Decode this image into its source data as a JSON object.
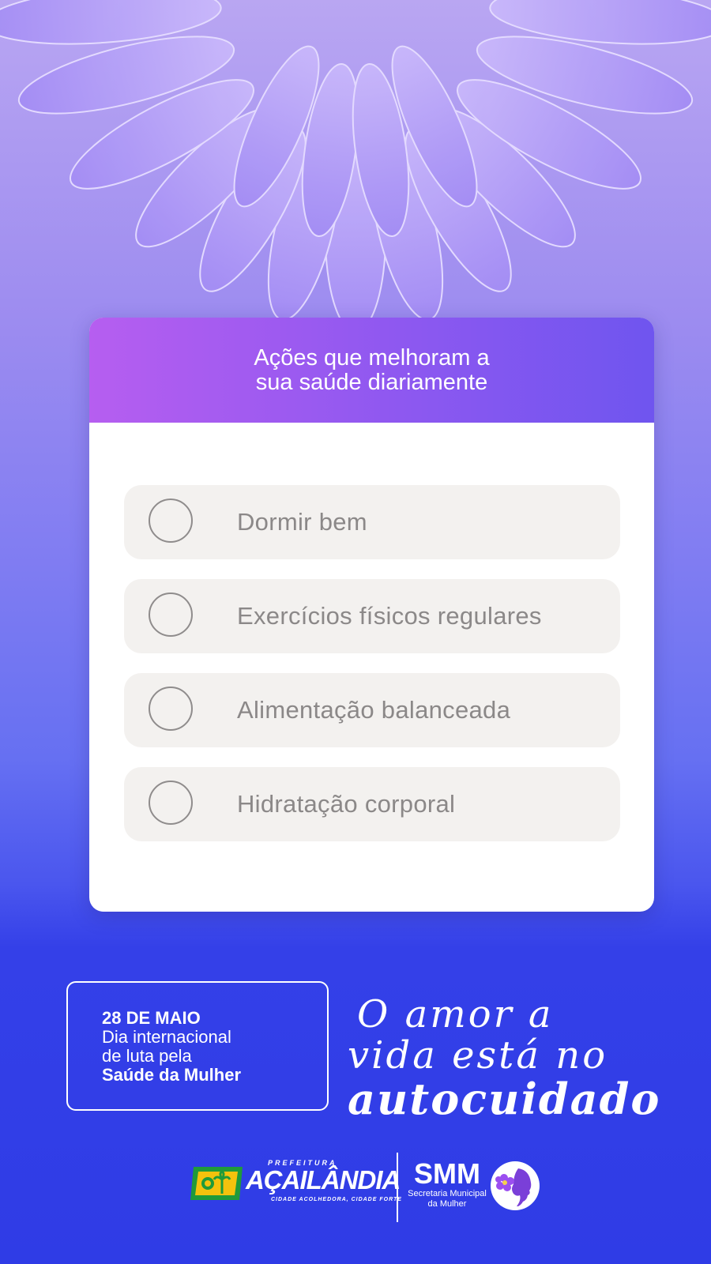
{
  "card": {
    "title_line1": "Ações que melhoram a",
    "title_line2": "sua saúde diariamente",
    "options": [
      {
        "label": "Dormir bem"
      },
      {
        "label": "Exercícios físicos regulares"
      },
      {
        "label": "Alimentação balanceada"
      },
      {
        "label": "Hidratação corporal"
      }
    ]
  },
  "date_box": {
    "date": "28 DE MAIO",
    "line1": "Dia internacional",
    "line2": "de luta pela",
    "line3": "Saúde da Mulher"
  },
  "slogan": {
    "line1": "O amor a",
    "line2": "vida está no",
    "line3": "autocuidado"
  },
  "footer": {
    "prefeitura_small": "PREFEITURA",
    "prefeitura_name": "AÇAILÂNDIA",
    "prefeitura_tagline": "CIDADE ACOLHEDORA, CIDADE FORTE",
    "smm_title": "SMM",
    "smm_sub1": "Secretaria Municipal",
    "smm_sub2": "da Mulher"
  },
  "colors": {
    "header_gradient_start": "#b65ef0",
    "header_gradient_end": "#6f55ef",
    "background_bottom": "#2f3ce6",
    "option_bg": "#f3f1ef",
    "option_text": "#8b8888"
  }
}
